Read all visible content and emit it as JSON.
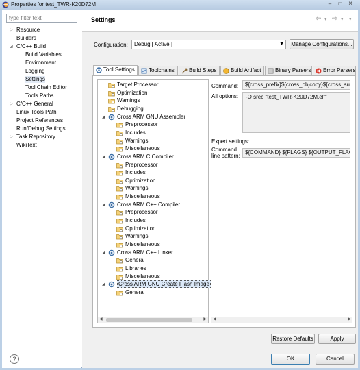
{
  "window": {
    "title": "Properties for test_TWR-K20D72M",
    "minimize": "–",
    "maximize": "□",
    "close": "×"
  },
  "left": {
    "filter_placeholder": "type filter text",
    "items": [
      {
        "label": "Resource",
        "toggle": "▷"
      },
      {
        "label": "Builders",
        "toggle": ""
      },
      {
        "label": "C/C++ Build",
        "toggle": "◢"
      },
      {
        "label": "Build Variables",
        "toggle": ""
      },
      {
        "label": "Environment",
        "toggle": ""
      },
      {
        "label": "Logging",
        "toggle": ""
      },
      {
        "label": "Settings",
        "toggle": "",
        "selected": true
      },
      {
        "label": "Tool Chain Editor",
        "toggle": ""
      },
      {
        "label": "Tools Paths",
        "toggle": ""
      },
      {
        "label": "C/C++ General",
        "toggle": "▷"
      },
      {
        "label": "Linux Tools Path",
        "toggle": ""
      },
      {
        "label": "Project References",
        "toggle": ""
      },
      {
        "label": "Run/Debug Settings",
        "toggle": ""
      },
      {
        "label": "Task Repository",
        "toggle": "▷"
      },
      {
        "label": "WikiText",
        "toggle": ""
      }
    ]
  },
  "header": {
    "title": "Settings",
    "back": "⇦",
    "back_menu": "▾",
    "forward": "⇨",
    "forward_menu": "▾",
    "menu": "▾"
  },
  "config": {
    "label": "Configuration:",
    "value": "Debug  [ Active ]",
    "manage_button": "Manage Configurations..."
  },
  "tabs": [
    {
      "label": "Tool Settings",
      "active": true
    },
    {
      "label": "Toolchains"
    },
    {
      "label": "Build Steps"
    },
    {
      "label": "Build Artifact"
    },
    {
      "label": "Binary Parsers"
    },
    {
      "label": "Error Parsers"
    }
  ],
  "tree": [
    {
      "label": "Target Processor",
      "icon": "folder-gear-icon"
    },
    {
      "label": "Optimization",
      "icon": "folder-gear-icon"
    },
    {
      "label": "Warnings",
      "icon": "folder-gear-icon"
    },
    {
      "label": "Debugging",
      "icon": "folder-gear-icon"
    },
    {
      "label": "Cross ARM GNU Assembler",
      "icon": "tool-icon",
      "toggle": "◢"
    },
    {
      "label": "Preprocessor",
      "icon": "folder-gear-icon"
    },
    {
      "label": "Includes",
      "icon": "folder-gear-icon"
    },
    {
      "label": "Warnings",
      "icon": "folder-gear-icon"
    },
    {
      "label": "Miscellaneous",
      "icon": "folder-gear-icon"
    },
    {
      "label": "Cross ARM C Compiler",
      "icon": "tool-icon",
      "toggle": "◢"
    },
    {
      "label": "Preprocessor",
      "icon": "folder-gear-icon"
    },
    {
      "label": "Includes",
      "icon": "folder-gear-icon"
    },
    {
      "label": "Optimization",
      "icon": "folder-gear-icon"
    },
    {
      "label": "Warnings",
      "icon": "folder-gear-icon"
    },
    {
      "label": "Miscellaneous",
      "icon": "folder-gear-icon"
    },
    {
      "label": "Cross ARM C++ Compiler",
      "icon": "tool-icon",
      "toggle": "◢"
    },
    {
      "label": "Preprocessor",
      "icon": "folder-gear-icon"
    },
    {
      "label": "Includes",
      "icon": "folder-gear-icon"
    },
    {
      "label": "Optimization",
      "icon": "folder-gear-icon"
    },
    {
      "label": "Warnings",
      "icon": "folder-gear-icon"
    },
    {
      "label": "Miscellaneous",
      "icon": "folder-gear-icon"
    },
    {
      "label": "Cross ARM C++ Linker",
      "icon": "tool-icon",
      "toggle": "◢"
    },
    {
      "label": "General",
      "icon": "folder-gear-icon"
    },
    {
      "label": "Libraries",
      "icon": "folder-gear-icon"
    },
    {
      "label": "Miscellaneous",
      "icon": "folder-gear-icon"
    },
    {
      "label": "Cross ARM GNU Create Flash Image",
      "icon": "tool-icon",
      "toggle": "◢",
      "selected": true
    },
    {
      "label": "General",
      "icon": "folder-gear-icon"
    }
  ],
  "details": {
    "command_label": "Command:",
    "command_value": "${cross_prefix}${cross_objcopy}${cross_suffix}",
    "all_options_label": "All options:",
    "all_options_value": "-O srec \"test_TWR-K20D72M.elf\"",
    "expert_label": "Expert settings:",
    "pattern_label_1": "Command",
    "pattern_label_2": "line pattern:",
    "pattern_value": "${COMMAND} ${FLAGS} ${OUTPUT_FLAG} ${OUTPUT_PREFIX}${OUTPUT} ${INPUTS}"
  },
  "buttons": {
    "restore_defaults": "Restore Defaults",
    "apply": "Apply",
    "ok": "OK",
    "cancel": "Cancel",
    "help": "?"
  },
  "colors": {
    "chrome": "#bcd0e6",
    "selection": "#dbe8f7",
    "default_button_border": "#3c7fb1"
  }
}
